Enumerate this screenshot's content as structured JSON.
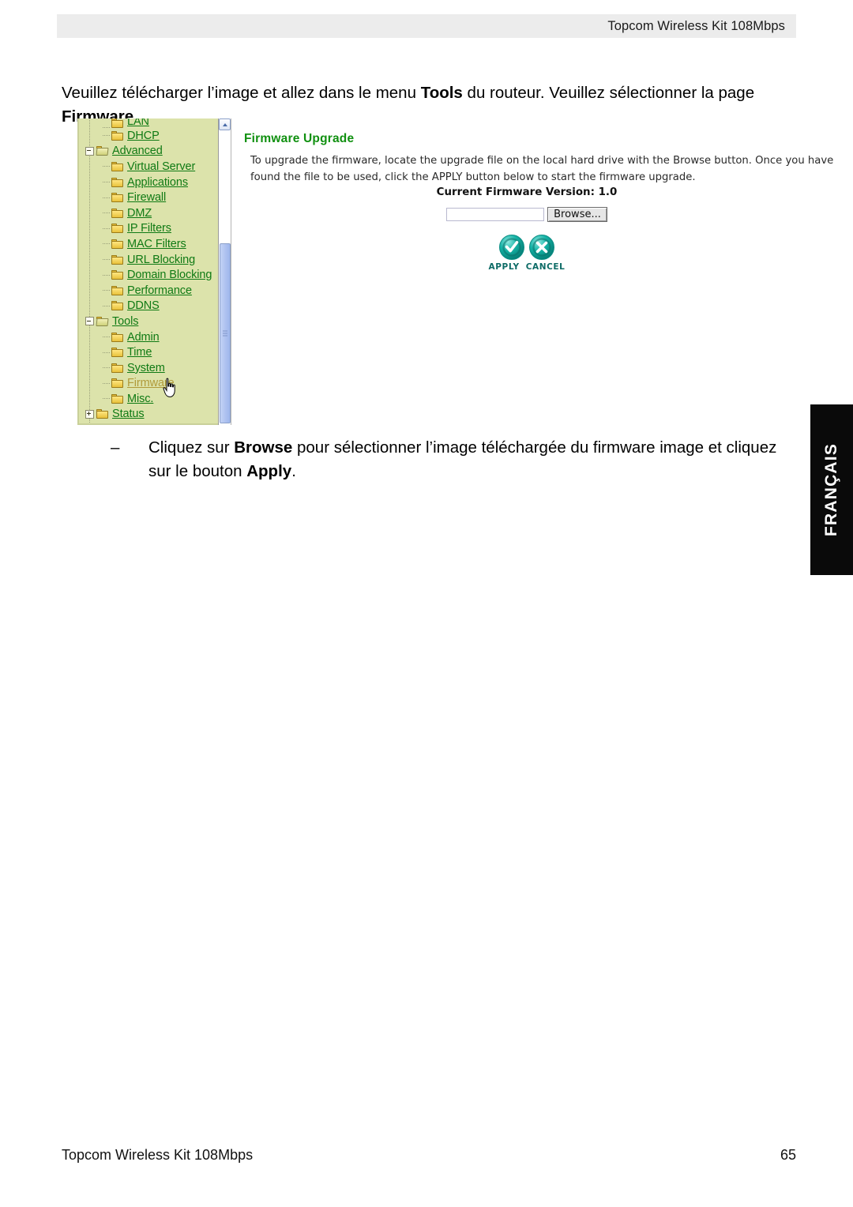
{
  "header": {
    "title": "Topcom Wireless Kit 108Mbps"
  },
  "intro": {
    "part1": "Veuillez télécharger l’image et allez dans le menu ",
    "bold1": "Tools",
    "part2": " du routeur. Veuillez sélectionner la page ",
    "bold2": "Firmware",
    "part3": "."
  },
  "screenshot": {
    "sidebar": {
      "items": [
        {
          "label": "LAN",
          "level": 2,
          "expander": "none",
          "folder": "closed",
          "active": false,
          "clipped": true
        },
        {
          "label": "DHCP",
          "level": 2,
          "expander": "none",
          "folder": "closed",
          "active": false
        },
        {
          "label": "Advanced",
          "level": 1,
          "expander": "minus",
          "folder": "open",
          "active": false
        },
        {
          "label": "Virtual Server",
          "level": 2,
          "expander": "none",
          "folder": "closed",
          "active": false
        },
        {
          "label": "Applications",
          "level": 2,
          "expander": "none",
          "folder": "closed",
          "active": false
        },
        {
          "label": "Firewall",
          "level": 2,
          "expander": "none",
          "folder": "closed",
          "active": false
        },
        {
          "label": "DMZ",
          "level": 2,
          "expander": "none",
          "folder": "closed",
          "active": false
        },
        {
          "label": "IP Filters",
          "level": 2,
          "expander": "none",
          "folder": "closed",
          "active": false
        },
        {
          "label": "MAC Filters",
          "level": 2,
          "expander": "none",
          "folder": "closed",
          "active": false
        },
        {
          "label": "URL Blocking",
          "level": 2,
          "expander": "none",
          "folder": "closed",
          "active": false
        },
        {
          "label": "Domain Blocking",
          "level": 2,
          "expander": "none",
          "folder": "closed",
          "active": false
        },
        {
          "label": "Performance",
          "level": 2,
          "expander": "none",
          "folder": "closed",
          "active": false
        },
        {
          "label": "DDNS",
          "level": 2,
          "expander": "none",
          "folder": "closed",
          "active": false
        },
        {
          "label": "Tools",
          "level": 1,
          "expander": "minus",
          "folder": "open",
          "active": false
        },
        {
          "label": "Admin",
          "level": 2,
          "expander": "none",
          "folder": "closed",
          "active": false
        },
        {
          "label": "Time",
          "level": 2,
          "expander": "none",
          "folder": "closed",
          "active": false
        },
        {
          "label": "System",
          "level": 2,
          "expander": "none",
          "folder": "closed",
          "active": false
        },
        {
          "label": "Firmware",
          "level": 2,
          "expander": "none",
          "folder": "closed",
          "active": true
        },
        {
          "label": "Misc.",
          "level": 2,
          "expander": "none",
          "folder": "closed",
          "active": false
        },
        {
          "label": "Status",
          "level": 1,
          "expander": "plus",
          "folder": "closed",
          "active": false
        }
      ]
    },
    "panel": {
      "title": "Firmware Upgrade",
      "description": "To upgrade the firmware, locate the upgrade file on the local hard drive with the Browse button. Once you have found the file to be used, click the APPLY button below to start the firmware upgrade.",
      "firmware_version": "Current Firmware Version: 1.0",
      "file_value": "",
      "file_placeholder": "",
      "browse_label": "Browse...",
      "apply_label": "APPLY",
      "cancel_label": "CANCEL"
    },
    "colors": {
      "sidebar_bg": "#dce3ab",
      "link": "#0f7a14",
      "active_link": "#b09a3a",
      "panel_title": "#109010",
      "action_icon": "#0aa79c"
    }
  },
  "bullet": {
    "dash": "–",
    "part1": "Cliquez sur ",
    "bold1": "Browse",
    "part2": " pour sélectionner l’image téléchargée du firmware image et cliquez sur le bouton ",
    "bold2": "Apply",
    "part3": "."
  },
  "language_tab": {
    "label": "FRANÇAIS"
  },
  "footer": {
    "left": "Topcom Wireless Kit 108Mbps",
    "page": "65"
  }
}
